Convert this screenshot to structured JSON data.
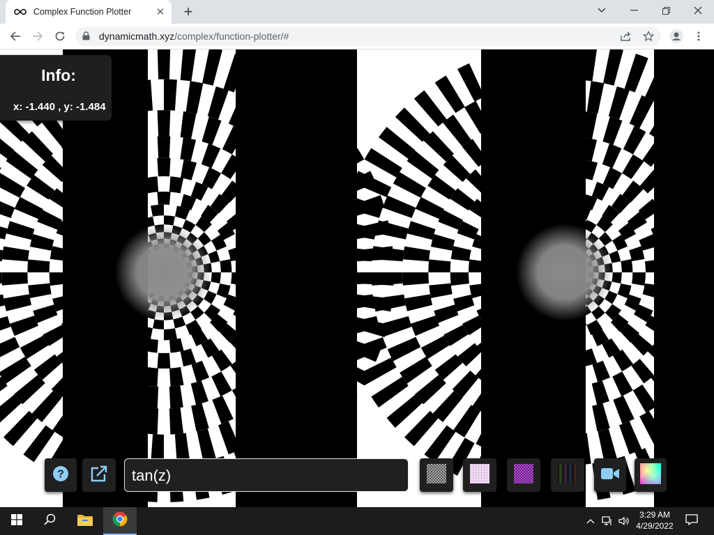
{
  "browser": {
    "tab_title": "Complex Function Plotter",
    "url_host": "dynamicmath.xyz",
    "url_path": "/complex/function-plotter/#"
  },
  "info_panel": {
    "title": "Info:",
    "coords": "x: -1.440 , y: -1.484"
  },
  "function_input": {
    "value": "tan(z)"
  },
  "controls": [
    {
      "name": "help",
      "icon": "question-circle-icon",
      "color": "#8ecdf5"
    },
    {
      "name": "open-external",
      "icon": "external-link-icon",
      "color": "#8ecdf5"
    },
    {
      "name": "texture-checker-gray",
      "icon": "checker-texture-icon"
    },
    {
      "name": "texture-grid-pink",
      "icon": "grid-texture-icon"
    },
    {
      "name": "texture-purple",
      "icon": "purple-texture-icon"
    },
    {
      "name": "texture-dark",
      "icon": "dark-texture-icon"
    },
    {
      "name": "camera",
      "icon": "video-camera-icon",
      "color": "#8ecdf5"
    },
    {
      "name": "color-wheel",
      "icon": "color-wheel-icon"
    }
  ],
  "taskbar": {
    "time": "3:29 AM",
    "date": "4/29/2022"
  },
  "colors": {
    "tab_strip": "#dee1e6",
    "panel_bg": "#202020",
    "accent_icon": "#8ecdf5"
  }
}
